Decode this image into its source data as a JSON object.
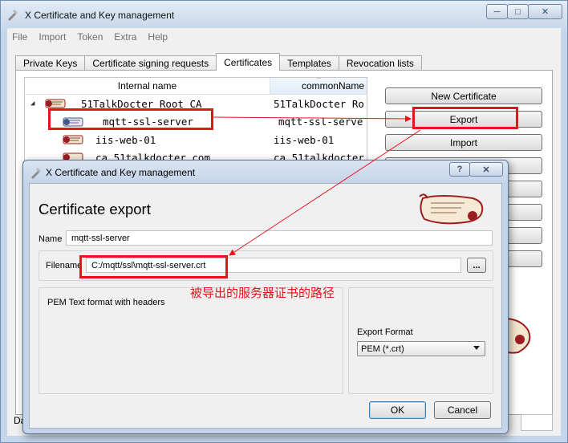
{
  "app": {
    "title": "X Certificate and Key management"
  },
  "window_buttons": {
    "minimize": "─",
    "maximize": "□",
    "close": "✕"
  },
  "menu": [
    "File",
    "Import",
    "Token",
    "Extra",
    "Help"
  ],
  "tabs": [
    "Private Keys",
    "Certificate signing requests",
    "Certificates",
    "Templates",
    "Revocation lists"
  ],
  "active_tab": "Certificates",
  "tree": {
    "columns": [
      "Internal name",
      "commonName"
    ],
    "rows": [
      {
        "name": "51TalkDocter Root CA",
        "common_name": "51TalkDocter Ro"
      },
      {
        "name": "mqtt-ssl-server",
        "common_name": "mqtt-ssl-serve"
      },
      {
        "name": "iis-web-01",
        "common_name": "iis-web-01"
      },
      {
        "name": "ca.51talkdocter.com",
        "common_name": "ca.51talkdocter"
      }
    ]
  },
  "side_buttons": [
    "New Certificate",
    "Export",
    "Import"
  ],
  "status": {
    "label": "Da"
  },
  "dialog": {
    "title": "X Certificate and Key management",
    "help": "?",
    "close": "✕",
    "heading": "Certificate export",
    "name_label": "Name",
    "name_value": "mqtt-ssl-server",
    "filename_label": "Filename",
    "filename_value": "C:/mqtt/ssl\\mqtt-ssl-server.crt",
    "browse": "...",
    "description": "PEM Text format with headers",
    "format_label": "Export Format",
    "format_value": "PEM (*.crt)",
    "ok": "OK",
    "cancel": "Cancel"
  },
  "annotation": {
    "text": "被导出的服务器证书的路径",
    "color": "#e8121a"
  },
  "colors": {
    "accent": "#e8121a",
    "seal_red": "#9b1d22",
    "titlebar": "#cad9ec"
  }
}
